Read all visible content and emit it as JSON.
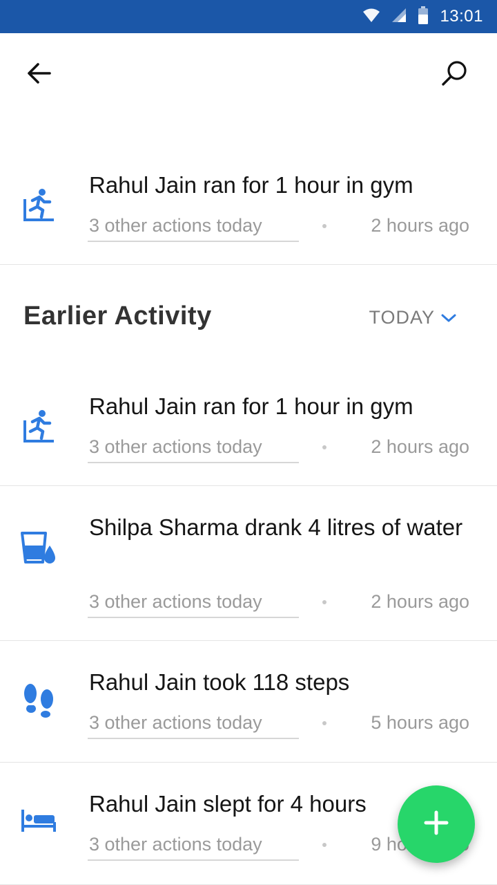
{
  "status_bar": {
    "time": "13:01",
    "icons": [
      "wifi-icon",
      "signal-icon",
      "battery-icon"
    ]
  },
  "topbar": {
    "back_icon": "arrow-left-icon",
    "search_icon": "search-icon"
  },
  "latest": {
    "icon": "running-icon",
    "title": "Rahul Jain ran for 1 hour in gym",
    "actions": "3 other actions today",
    "time": "2 hours ago"
  },
  "section": {
    "title": "Earlier Activity",
    "filter": "TODAY",
    "filter_icon": "chevron-down-icon"
  },
  "activities": [
    {
      "icon": "running-icon",
      "title": "Rahul Jain ran for 1 hour in gym",
      "actions": "3 other actions today",
      "time": "2 hours ago"
    },
    {
      "icon": "water-icon",
      "title": "Shilpa Sharma drank 4 litres of water",
      "actions": "3 other actions today",
      "time": "2 hours ago"
    },
    {
      "icon": "footsteps-icon",
      "title": "Rahul Jain took 118 steps",
      "actions": "3 other actions today",
      "time": "5 hours ago"
    },
    {
      "icon": "bed-icon",
      "title": "Rahul Jain slept for 4 hours",
      "actions": "3 other actions today",
      "time": "9 hours ago"
    }
  ],
  "fab": {
    "icon": "plus-icon"
  },
  "colors": {
    "status_bar": "#1b57a8",
    "icon_blue": "#2f7ce0",
    "fab": "#27d66a",
    "meta_text": "#9a9a9a"
  }
}
